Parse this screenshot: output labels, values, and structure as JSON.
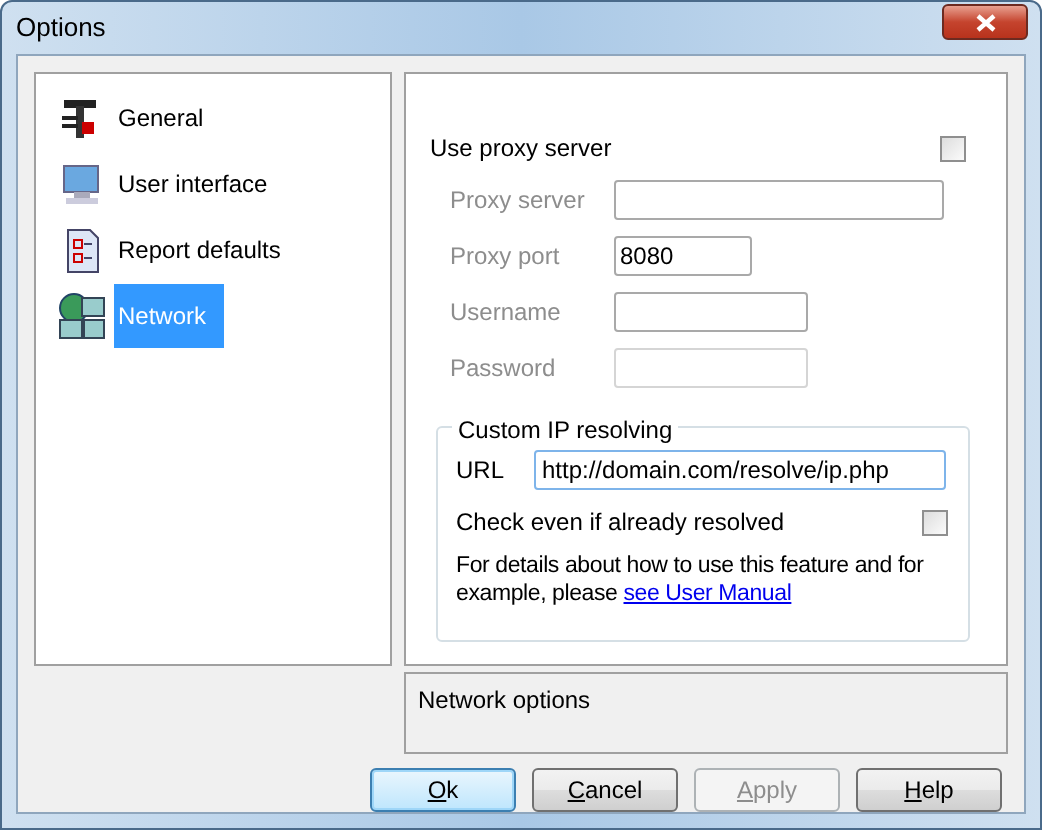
{
  "window": {
    "title": "Options"
  },
  "sidebar": {
    "items": [
      {
        "label": "General",
        "selected": false
      },
      {
        "label": "User interface",
        "selected": false
      },
      {
        "label": "Report defaults",
        "selected": false
      },
      {
        "label": "Network",
        "selected": true
      }
    ]
  },
  "proxy": {
    "label": "Use proxy server",
    "checked": false,
    "fields": [
      {
        "label": "Proxy server",
        "disabled": false
      },
      {
        "label": "Proxy port",
        "value": "8080",
        "disabled": false
      },
      {
        "label": "Username",
        "disabled": false
      },
      {
        "label": "Password",
        "disabled": true
      }
    ]
  },
  "custom_ip": {
    "title": "Custom IP resolving",
    "url_label": "URL",
    "url": "http://domain.com/resolve/ip.php",
    "check_label": "Check even if already resolved",
    "checked": false,
    "note": "For details about how to use this feature and for example, please ",
    "link": "see User Manual"
  },
  "description": "Network options",
  "buttons": [
    {
      "label": "Ok",
      "default": true,
      "disabled": false
    },
    {
      "label": "Cancel",
      "default": false,
      "disabled": false
    },
    {
      "label": "Apply",
      "default": false,
      "disabled": true
    },
    {
      "label": "Help",
      "default": false,
      "disabled": false
    }
  ]
}
